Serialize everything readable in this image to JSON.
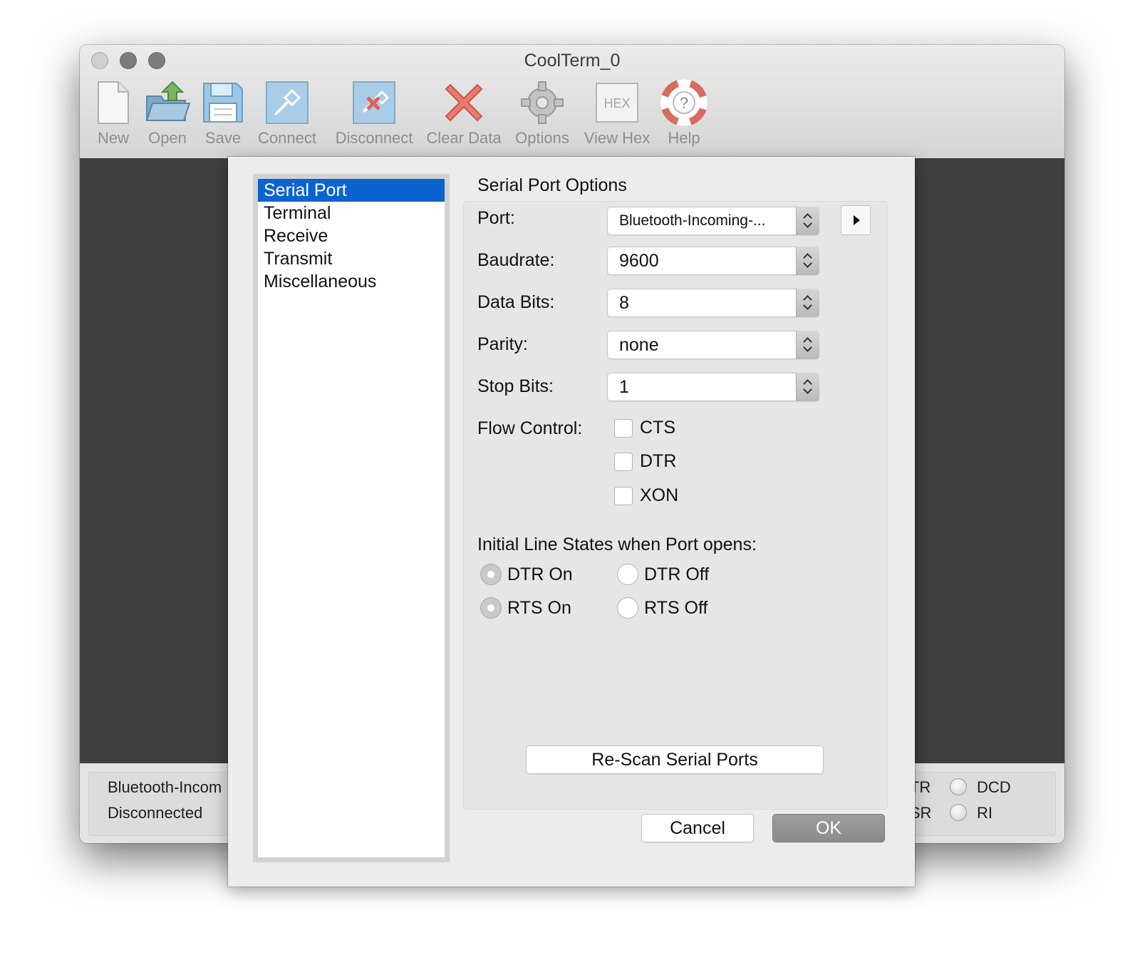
{
  "window": {
    "title": "CoolTerm_0",
    "toolbar": [
      {
        "id": "new",
        "label": "New",
        "icon": "new-document-icon"
      },
      {
        "id": "open",
        "label": "Open",
        "icon": "open-folder-icon"
      },
      {
        "id": "save",
        "label": "Save",
        "icon": "floppy-disk-icon"
      },
      {
        "id": "connect",
        "label": "Connect",
        "icon": "connect-plug-icon"
      },
      {
        "id": "disconnect",
        "label": "Disconnect",
        "icon": "disconnect-plug-icon"
      },
      {
        "id": "clear",
        "label": "Clear Data",
        "icon": "red-x-icon"
      },
      {
        "id": "options",
        "label": "Options",
        "icon": "gear-icon"
      },
      {
        "id": "hex",
        "label": "View Hex",
        "icon": "hex-icon",
        "icon_text": "HEX"
      },
      {
        "id": "help",
        "label": "Help",
        "icon": "lifebuoy-help-icon"
      }
    ]
  },
  "status": {
    "port": "Bluetooth-Incom",
    "state": "Disconnected",
    "lines": {
      "dtr": "DTR",
      "dsr": "DSR",
      "dcd": "DCD",
      "ri": "RI"
    }
  },
  "options": {
    "categories": [
      "Serial Port",
      "Terminal",
      "Receive",
      "Transmit",
      "Miscellaneous"
    ],
    "selected_category": "Serial Port",
    "section_title": "Serial Port Options",
    "port": {
      "label": "Port:",
      "value": "Bluetooth-Incoming-..."
    },
    "baudrate": {
      "label": "Baudrate:",
      "value": "9600"
    },
    "data_bits": {
      "label": "Data Bits:",
      "value": "8"
    },
    "parity": {
      "label": "Parity:",
      "value": "none"
    },
    "stop_bits": {
      "label": "Stop Bits:",
      "value": "1"
    },
    "flow_control": {
      "label": "Flow Control:",
      "cts": {
        "label": "CTS",
        "checked": false
      },
      "dtr": {
        "label": "DTR",
        "checked": false
      },
      "xon": {
        "label": "XON",
        "checked": false
      }
    },
    "initial_states": {
      "label": "Initial Line States when Port opens:",
      "dtr_on": {
        "label": "DTR On",
        "selected": true
      },
      "dtr_off": {
        "label": "DTR Off",
        "selected": false
      },
      "rts_on": {
        "label": "RTS On",
        "selected": true
      },
      "rts_off": {
        "label": "RTS Off",
        "selected": false
      }
    },
    "rescan_label": "Re-Scan Serial Ports",
    "cancel_label": "Cancel",
    "ok_label": "OK"
  }
}
